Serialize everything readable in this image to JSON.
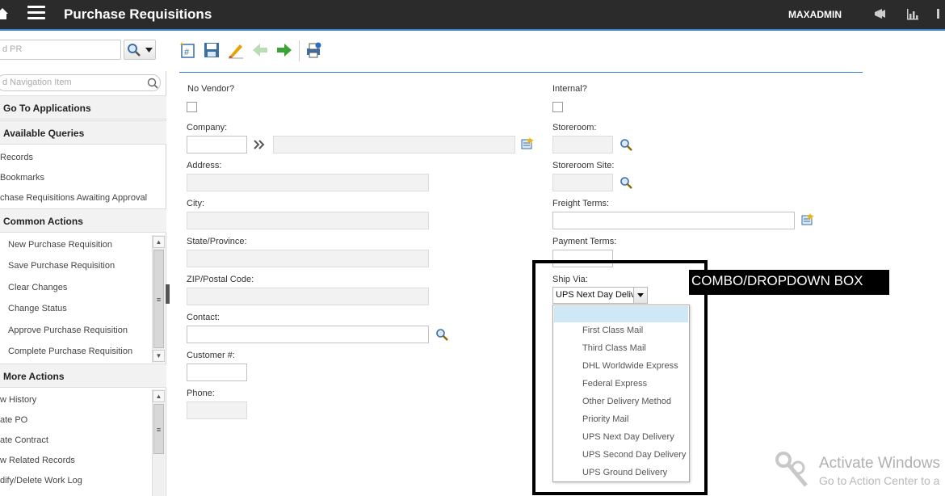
{
  "app": {
    "title": "Purchase Requisitions",
    "user": "MAXADMIN"
  },
  "toolbar": {
    "search_placeholder": "d PR"
  },
  "nav": {
    "search_placeholder": "d Navigation Item",
    "go_to_applications": "Go To Applications",
    "available_queries": "Available Queries",
    "queries": [
      "Records",
      "Bookmarks",
      "chase Requisitions Awaiting Approval"
    ],
    "common_actions": "Common Actions",
    "common_items": [
      "New Purchase Requisition",
      "Save Purchase Requisition",
      "Clear Changes",
      "Change Status",
      "Approve Purchase Requisition",
      "Complete Purchase Requisition"
    ],
    "more_actions": "More Actions",
    "more_items": [
      "w History",
      "ate PO",
      "ate Contract",
      "w Related Records",
      "dify/Delete Work Log"
    ]
  },
  "form": {
    "no_vendor_label": "No Vendor?",
    "company_label": "Company:",
    "address_label": "Address:",
    "city_label": "City:",
    "state_label": "State/Province:",
    "zip_label": "ZIP/Postal Code:",
    "contact_label": "Contact:",
    "customer_label": "Customer #:",
    "phone_label": "Phone:",
    "internal_label": "Internal?",
    "storeroom_label": "Storeroom:",
    "storeroom_site_label": "Storeroom Site:",
    "freight_terms_label": "Freight Terms:",
    "payment_terms_label": "Payment Terms:",
    "ship_via_label": "Ship Via:",
    "ship_via_value": "UPS Next Day Delivery"
  },
  "ship_via_options": [
    "",
    "First Class Mail",
    "Third Class Mail",
    "DHL Worldwide Express",
    "Federal Express",
    "Other Delivery Method",
    "Priority Mail",
    "UPS Next Day Delivery",
    "UPS Second Day Delivery",
    "UPS Ground Delivery"
  ],
  "annotation": {
    "label": "COMBO/DROPDOWN BOX"
  },
  "watermark": {
    "line1": "Activate Windows",
    "line2": "Go to Action Center to a"
  }
}
